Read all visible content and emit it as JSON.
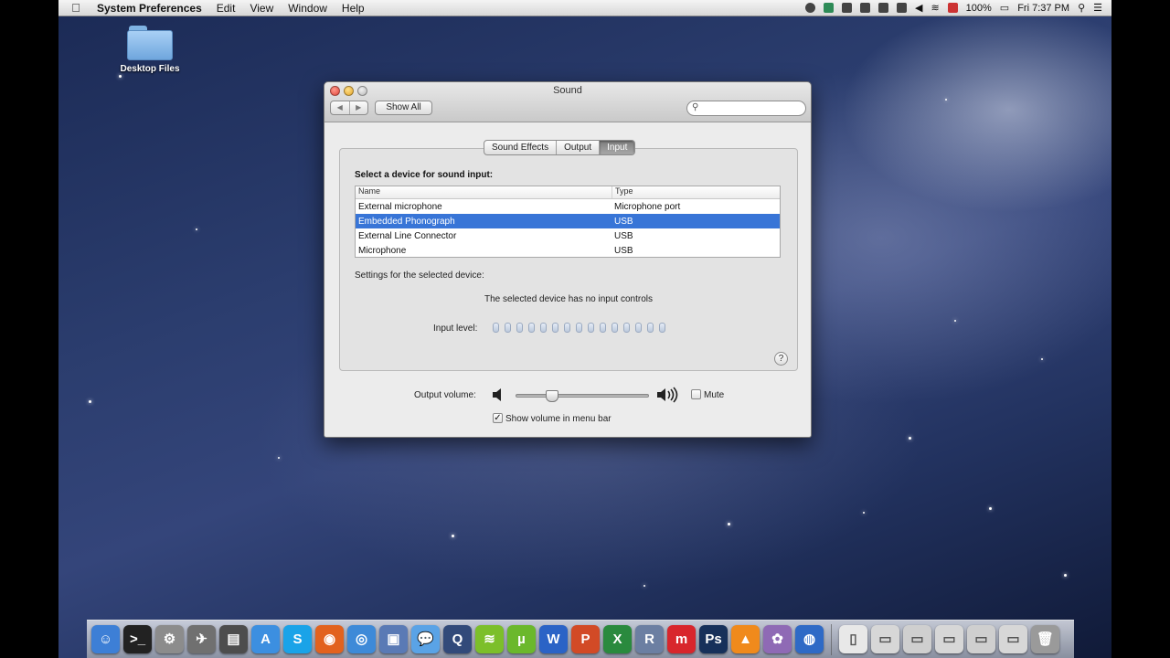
{
  "menubar": {
    "apple": "",
    "items": [
      "System Preferences",
      "Edit",
      "View",
      "Window",
      "Help"
    ],
    "battery": "100%",
    "clock": "Fri 7:37 PM"
  },
  "desktop": {
    "icon_label": "Desktop Files"
  },
  "window": {
    "title": "Sound",
    "show_all": "Show All",
    "nav_back": "◀",
    "nav_forward": "▶",
    "tabs": [
      "Sound Effects",
      "Output",
      "Input"
    ],
    "active_tab": "Input",
    "heading": "Select a device for sound input:",
    "table": {
      "headers": [
        "Name",
        "Type"
      ],
      "rows": [
        {
          "name": "External microphone",
          "type": "Microphone port"
        },
        {
          "name": "Embedded Phonograph",
          "type": "USB"
        },
        {
          "name": "External Line Connector",
          "type": "USB"
        },
        {
          "name": "Microphone",
          "type": "USB"
        }
      ],
      "selected_row": 1
    },
    "settings_label": "Settings for the selected device:",
    "no_controls": "The selected device has no input controls",
    "input_level_label": "Input level:",
    "input_level_segments": 15,
    "help": "?",
    "output_volume_label": "Output volume:",
    "output_volume": 0.27,
    "mute_label": "Mute",
    "mute_checked": false,
    "show_volume_label": "Show volume in menu bar",
    "show_volume_checked": true
  },
  "dock": {
    "apps": [
      {
        "name": "finder",
        "glyph": "☺",
        "color": "#3d7fd6"
      },
      {
        "name": "terminal",
        "glyph": ">_",
        "color": "#222"
      },
      {
        "name": "system-preferences",
        "glyph": "⚙",
        "color": "#8c8c8c"
      },
      {
        "name": "launchpad",
        "glyph": "✈",
        "color": "#707070"
      },
      {
        "name": "activity-monitor",
        "glyph": "▤",
        "color": "#4d4d4d"
      },
      {
        "name": "app-store",
        "glyph": "A",
        "color": "#3c8fe0"
      },
      {
        "name": "skype",
        "glyph": "S",
        "color": "#1aa3e8"
      },
      {
        "name": "firefox",
        "glyph": "◉",
        "color": "#e2621e"
      },
      {
        "name": "safari",
        "glyph": "◎",
        "color": "#3e8ad8"
      },
      {
        "name": "preview",
        "glyph": "▣",
        "color": "#5a7ab5"
      },
      {
        "name": "messages",
        "glyph": "💬",
        "color": "#5aa3e6"
      },
      {
        "name": "quicktime",
        "glyph": "Q",
        "color": "#324a7a"
      },
      {
        "name": "spotify",
        "glyph": "≋",
        "color": "#7cbf2a"
      },
      {
        "name": "utorrent",
        "glyph": "µ",
        "color": "#6bb82c"
      },
      {
        "name": "word",
        "glyph": "W",
        "color": "#2b63c6"
      },
      {
        "name": "powerpoint",
        "glyph": "P",
        "color": "#d24a26"
      },
      {
        "name": "excel",
        "glyph": "X",
        "color": "#2a8a3e"
      },
      {
        "name": "r-studio",
        "glyph": "R",
        "color": "#6c7fa2"
      },
      {
        "name": "mega",
        "glyph": "m",
        "color": "#d8262c"
      },
      {
        "name": "photoshop",
        "glyph": "Ps",
        "color": "#17305a"
      },
      {
        "name": "vlc",
        "glyph": "▲",
        "color": "#f08a1c"
      },
      {
        "name": "photos",
        "glyph": "✿",
        "color": "#8f6ab5"
      },
      {
        "name": "network-utility",
        "glyph": "◍",
        "color": "#2f6ac6"
      }
    ],
    "docs": [
      {
        "name": "document",
        "glyph": "▯",
        "color": "#e8e8e8"
      },
      {
        "name": "screenshot-1",
        "glyph": "▭",
        "color": "#d7d7d7"
      },
      {
        "name": "screenshot-2",
        "glyph": "▭",
        "color": "#cfcfcf"
      },
      {
        "name": "screenshot-3",
        "glyph": "▭",
        "color": "#d7d7d7"
      },
      {
        "name": "screenshot-4",
        "glyph": "▭",
        "color": "#cfcfcf"
      },
      {
        "name": "screenshot-5",
        "glyph": "▭",
        "color": "#d7d7d7"
      },
      {
        "name": "trash",
        "glyph": "🗑",
        "color": "#9a9a9a"
      }
    ]
  }
}
